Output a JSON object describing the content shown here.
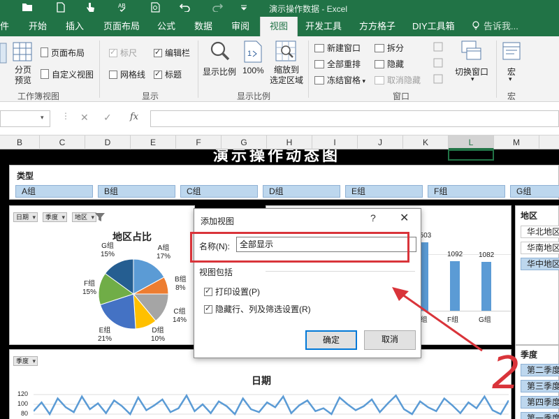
{
  "window": {
    "title": "演示操作数据 - Excel"
  },
  "tabs": [
    {
      "label": "件"
    },
    {
      "label": "开始"
    },
    {
      "label": "插入"
    },
    {
      "label": "页面布局"
    },
    {
      "label": "公式"
    },
    {
      "label": "数据"
    },
    {
      "label": "审阅"
    },
    {
      "label": "视图"
    },
    {
      "label": "开发工具"
    },
    {
      "label": "方方格子"
    },
    {
      "label": "DIY工具箱"
    },
    {
      "label": "告诉我..."
    }
  ],
  "ribbon": {
    "workbook_views": {
      "label": "工作簿视图",
      "page_break_preview": "分页\n预览",
      "page_layout": "页面布局",
      "custom_views": "自定义视图"
    },
    "show": {
      "label": "显示",
      "ruler": "标尺",
      "formula_bar": "编辑栏",
      "gridlines": "网格线",
      "headings": "标题"
    },
    "zoom": {
      "label": "显示比例",
      "zoom": "显示比例",
      "hundred": "100%",
      "zoom_to_selection": "缩放到\n选定区域"
    },
    "window_group": {
      "label": "窗口",
      "new_window": "新建窗口",
      "arrange_all": "全部重排",
      "freeze_panes": "冻结窗格",
      "split": "拆分",
      "hide": "隐藏",
      "unhide": "取消隐藏",
      "switch_windows": "切换窗口"
    },
    "macros": {
      "label": "宏",
      "macros": "宏"
    }
  },
  "formula_bar": {
    "fx": "fx"
  },
  "columns": [
    "B",
    "C",
    "D",
    "E",
    "F",
    "G",
    "H",
    "I",
    "J",
    "K",
    "L",
    "M"
  ],
  "sheet": {
    "title": "演示操作动态图",
    "type_slicer": {
      "title": "类型",
      "items": [
        "A组",
        "B组",
        "C组",
        "D组",
        "E组",
        "F组",
        "G组"
      ]
    },
    "region_slicer": {
      "title": "地区",
      "items": [
        "华北地区",
        "华南地区",
        "华中地区"
      ]
    },
    "season_slicer": {
      "title": "季度",
      "items": [
        "第二季度",
        "第三季度",
        "第四季度",
        "第一季度"
      ]
    },
    "pie_fields": [
      "日期",
      "季度",
      "地区"
    ],
    "line_fields": [
      "季度"
    ],
    "line_title": "日期"
  },
  "pie_chart": {
    "title": "地区占比",
    "labels": [
      {
        "name": "G组",
        "pct": "15%"
      },
      {
        "name": "A组",
        "pct": "17%"
      },
      {
        "name": "B组",
        "pct": "8%"
      },
      {
        "name": "C组",
        "pct": "14%"
      },
      {
        "name": "D组",
        "pct": "10%"
      },
      {
        "name": "E组",
        "pct": "21%"
      },
      {
        "name": "F组",
        "pct": "15%"
      }
    ]
  },
  "chart_data": [
    {
      "type": "pie",
      "title": "地区占比",
      "categories": [
        "A组",
        "B组",
        "C组",
        "D组",
        "E组",
        "F组",
        "G组"
      ],
      "values": [
        17,
        8,
        14,
        10,
        21,
        15,
        15
      ],
      "colors": [
        "#5b9bd5",
        "#ed7d31",
        "#a5a5a5",
        "#ffc000",
        "#4472c4",
        "#70ad47",
        "#255e91"
      ]
    },
    {
      "type": "bar",
      "categories": [
        "E组",
        "F组",
        "G组"
      ],
      "values": [
        1503,
        1092,
        1082
      ],
      "color": "#5b9bd5"
    },
    {
      "type": "line",
      "title": "日期",
      "ylim": [
        80,
        120
      ],
      "y_ticks": [
        120,
        100,
        80
      ],
      "color": "#5b9bd5",
      "values": [
        86,
        104,
        80,
        112,
        94,
        84,
        116,
        90,
        102,
        82,
        108,
        96,
        80,
        114,
        88,
        98,
        110,
        84,
        92,
        118,
        86,
        100,
        82,
        106,
        96,
        80,
        112,
        90,
        84,
        104,
        94,
        116,
        82,
        98,
        108,
        86,
        92,
        80,
        114,
        100,
        88,
        96,
        110,
        84,
        102,
        118,
        90,
        80,
        106,
        94,
        86,
        112,
        98,
        82,
        104,
        92,
        116,
        88,
        80,
        108
      ]
    }
  ],
  "dialog": {
    "title": "添加视图",
    "help": "?",
    "close": "✕",
    "name_label": "名称(N):",
    "name_value": "全部显示",
    "group_label": "视图包括",
    "print_settings": "打印设置(P)",
    "hidden_rows": "隐藏行、列及筛选设置(R)",
    "ok": "确定",
    "cancel": "取消"
  },
  "annotation": {
    "number": "2",
    "color": "#d9343a"
  }
}
